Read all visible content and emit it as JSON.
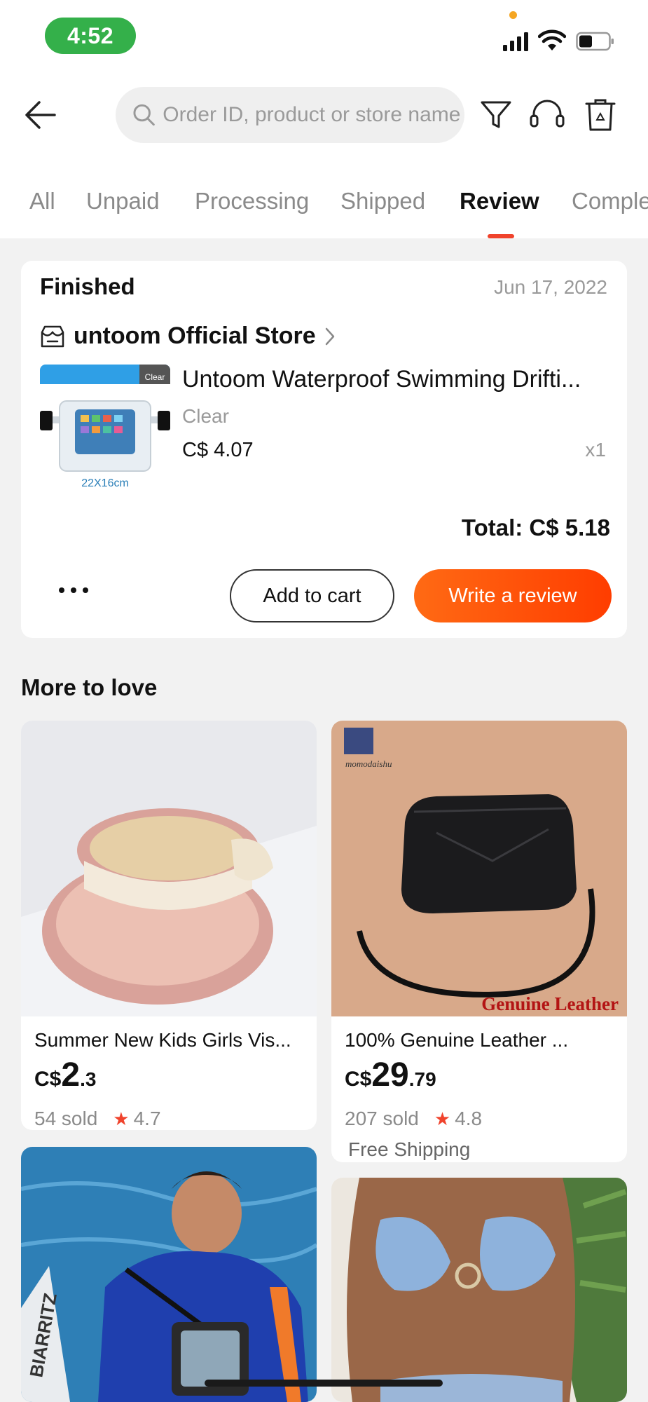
{
  "status_bar": {
    "time": "4:52"
  },
  "header": {
    "search_placeholder": "Order ID, product or store name",
    "icons": [
      "back-arrow-icon",
      "search-icon",
      "filter-icon",
      "headset-icon",
      "trash-icon"
    ]
  },
  "tabs": [
    {
      "label": "All",
      "active": false
    },
    {
      "label": "Unpaid",
      "active": false
    },
    {
      "label": "Processing",
      "active": false
    },
    {
      "label": "Shipped",
      "active": false
    },
    {
      "label": "Review",
      "active": true
    },
    {
      "label": "Comple",
      "active": false
    }
  ],
  "order": {
    "status": "Finished",
    "date": "Jun 17, 2022",
    "store_name": "untoom Official Store",
    "product_title": "Untoom Waterproof Swimming Drifti...",
    "thumb_badge": "Clear",
    "thumb_caption": "22X16cm",
    "variant": "Clear",
    "price": "C$ 4.07",
    "quantity": "x1",
    "total": "Total: C$ 5.18",
    "more_label": "•••",
    "add_to_cart_label": "Add to cart",
    "write_review_label": "Write a review"
  },
  "more_to_love": {
    "title": "More to love",
    "items": [
      {
        "title": "Summer New Kids Girls Vis...",
        "currency": "C$",
        "price_int": "2",
        "price_dec": ".3",
        "sold": "54 sold",
        "rating": "4.7",
        "shipping": ""
      },
      {
        "title": "100% Genuine Leather ...",
        "currency": "C$",
        "price_int": "29",
        "price_dec": ".79",
        "sold": "207 sold",
        "rating": "4.8",
        "shipping": "Free Shipping",
        "image_text": "Genuine Leather",
        "brand_mark": "momodaishu"
      },
      {
        "title": "",
        "image_text": "BIARRITZ"
      },
      {
        "title": ""
      }
    ]
  },
  "colors": {
    "accent": "#ff4a0a",
    "tab_indicator": "#f0432c",
    "time_pill": "#34b04a",
    "star": "#f0432c"
  }
}
